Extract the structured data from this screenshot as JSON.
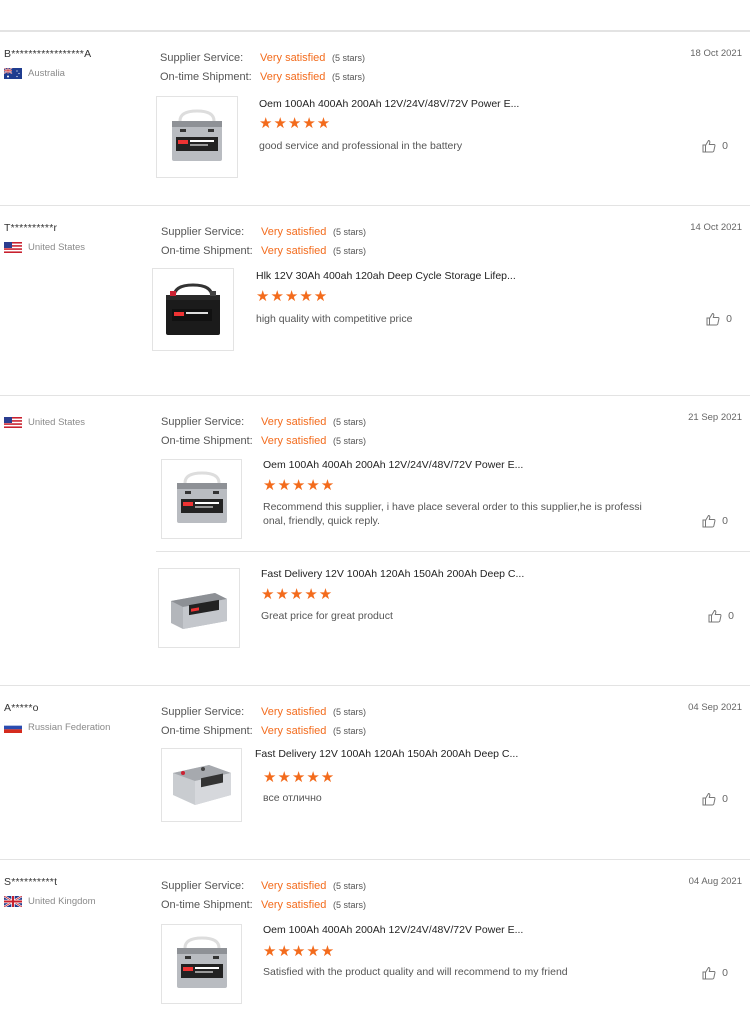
{
  "labels": {
    "supplier_service": "Supplier Service:",
    "ontime_shipment": "On-time Shipment:",
    "very_satisfied": "Very satisfied",
    "five_stars": "(5 stars)"
  },
  "colors": {
    "accent": "#f36b1c",
    "border": "#e3e3e3",
    "muted": "#8a8a8a"
  },
  "reviews": [
    {
      "buyer": "B*****************A",
      "country": "Australia",
      "flag": "au-flag-icon",
      "date": "18 Oct 2021",
      "products": [
        {
          "title": "Oem 100Ah 400Ah 200Ah 12V/24V/48V/72V Power E...",
          "stars": "★★★★★",
          "rating": 5,
          "comment": "good service and professional in the battery",
          "likes": "0",
          "image": "grey-battery-with-handle"
        }
      ]
    },
    {
      "buyer": "T**********r",
      "country": "United States",
      "flag": "us-flag-icon",
      "date": "14 Oct 2021",
      "products": [
        {
          "title": "Hlk 12V 30Ah 400ah 120ah Deep Cycle Storage Lifep...",
          "stars": "★★★★★",
          "rating": 5,
          "comment": "high quality with competitive price",
          "likes": "0",
          "image": "black-battery-with-handle"
        }
      ]
    },
    {
      "buyer": "",
      "country": "United States",
      "flag": "us-flag-icon",
      "date": "21 Sep 2021",
      "products": [
        {
          "title": "Oem 100Ah 400Ah 200Ah 12V/24V/48V/72V Power E...",
          "stars": "★★★★★",
          "rating": 5,
          "comment": "Recommend this supplier, i have place several order to this supplier,he is professi onal, friendly, quick reply.",
          "likes": "0",
          "image": "grey-battery-with-handle"
        },
        {
          "title": "Fast Delivery 12V 100Ah 120Ah 150Ah 200Ah Deep C...",
          "stars": "★★★★★",
          "rating": 5,
          "comment": "Great price for great product",
          "likes": "0",
          "image": "grey-long-battery"
        }
      ]
    },
    {
      "buyer": "A*****o",
      "country": "Russian Federation",
      "flag": "ru-flag-icon",
      "date": "04 Sep 2021",
      "products": [
        {
          "title": "Fast Delivery 12V 100Ah 120Ah 150Ah 200Ah Deep C...",
          "stars": "★★★★★",
          "rating": 5,
          "comment": "все отлично",
          "likes": "0",
          "image": "grey-long-battery"
        }
      ]
    },
    {
      "buyer": "S**********t",
      "country": "United Kingdom",
      "flag": "uk-flag-icon",
      "date": "04 Aug 2021",
      "products": [
        {
          "title": "Oem 100Ah 400Ah 200Ah 12V/24V/48V/72V Power E...",
          "stars": "★★★★★",
          "rating": 5,
          "comment": "Satisfied with the product quality and will recommend to my friend",
          "likes": "0",
          "image": "grey-battery-with-handle"
        }
      ]
    }
  ]
}
